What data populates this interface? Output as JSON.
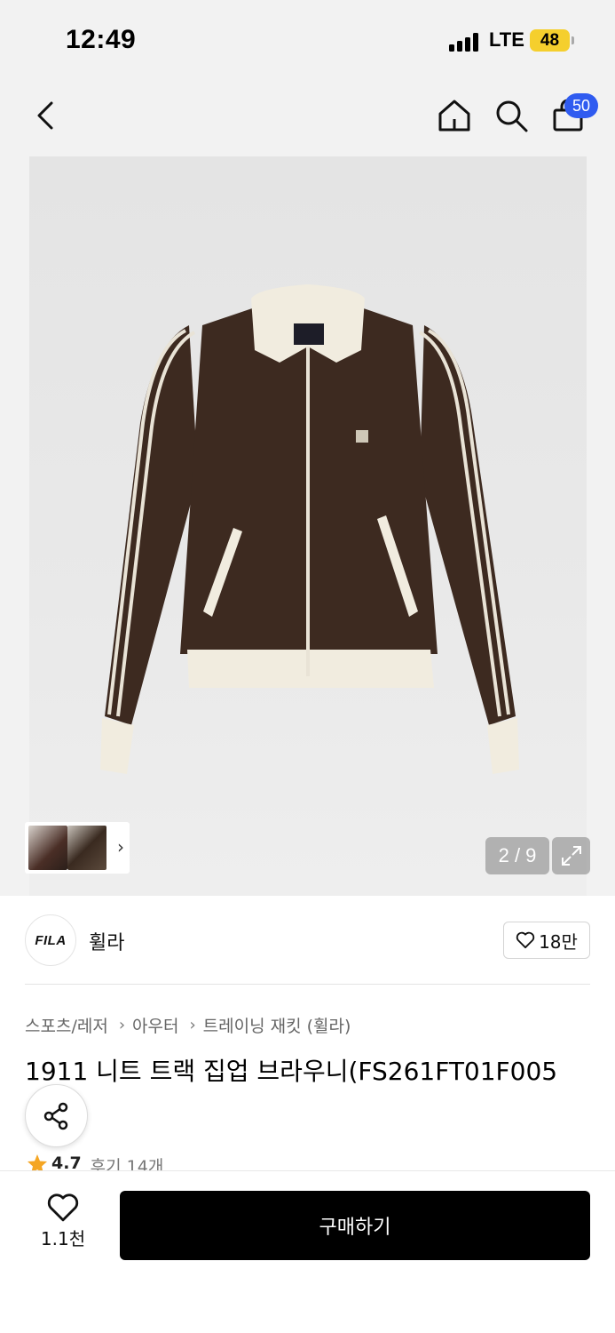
{
  "status_bar": {
    "time": "12:49",
    "network": "LTE",
    "battery": "48"
  },
  "nav": {
    "cart_count": "50"
  },
  "gallery": {
    "counter": "2 / 9"
  },
  "brand": {
    "logo_text": "FILA",
    "name": "휠라",
    "likes": "18만"
  },
  "breadcrumb": {
    "items": [
      "스포츠/레저",
      "아우터",
      "트레이닝 재킷 (휠라)"
    ]
  },
  "product": {
    "title": "1911 니트 트랙 집업 브라우니(FS261FT01F005",
    "rating": "4.7",
    "review_label": "후기 14개"
  },
  "bottom_bar": {
    "wish_count": "1.1천",
    "buy_label": "구매하기"
  },
  "colors": {
    "accent_badge": "#2f5bf0",
    "battery": "#f5cf2d",
    "star": "#f5a623",
    "buy_button": "#000000",
    "jacket_body": "#3d2a20",
    "jacket_trim": "#f1ecdf"
  }
}
